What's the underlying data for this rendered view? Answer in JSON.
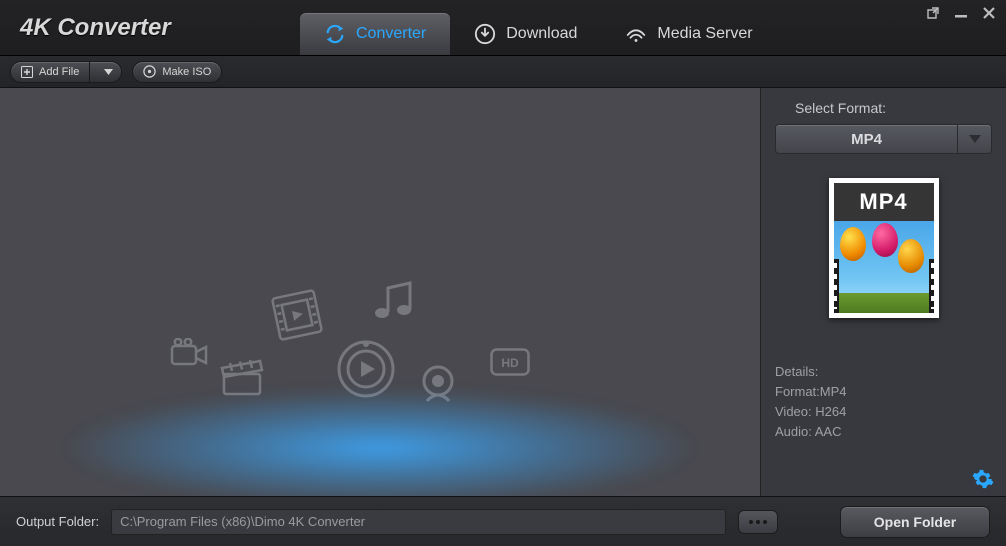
{
  "app": {
    "title": "4K Converter"
  },
  "tabs": [
    {
      "label": "Converter",
      "active": true
    },
    {
      "label": "Download",
      "active": false
    },
    {
      "label": "Media Server",
      "active": false
    }
  ],
  "toolbar": {
    "add_file_label": "Add File",
    "make_iso_label": "Make ISO"
  },
  "sidebar": {
    "select_format_label": "Select Format:",
    "selected_format": "MP4",
    "thumb_label": "MP4",
    "details_heading": "Details:",
    "detail_format": "Format:MP4",
    "detail_video": "Video: H264",
    "detail_audio": "Audio: AAC"
  },
  "footer": {
    "output_folder_label": "Output Folder:",
    "output_folder_path": "C:\\Program Files (x86)\\Dimo 4K Converter",
    "open_folder_label": "Open Folder"
  }
}
